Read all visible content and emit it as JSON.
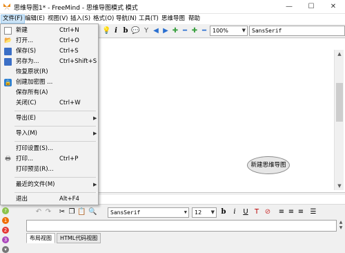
{
  "window": {
    "title": "思维导图1* - FreeMind - 思维导图模式 模式",
    "minimize": "—",
    "maximize": "☐",
    "close": "✕"
  },
  "menubar": {
    "items": [
      "文件(F)",
      "编辑(E)",
      "视图(V)",
      "插入(S)",
      "格式(O)",
      "导航(N)",
      "工具(T)",
      "思维导图",
      "帮助"
    ]
  },
  "toolbar": {
    "zoom": "100%",
    "font": "SansSerif"
  },
  "file_menu": {
    "items": [
      {
        "label": "新建",
        "shortcut": "Ctrl+N",
        "icon": "new-file-icon"
      },
      {
        "label": "打开...",
        "shortcut": "Ctrl+O",
        "icon": "open-folder-icon"
      },
      {
        "label": "保存(S)",
        "shortcut": "Ctrl+S",
        "icon": "save-icon"
      },
      {
        "label": "另存为...",
        "shortcut": "Ctrl+Shift+S",
        "icon": "save-as-icon"
      },
      {
        "label": "恢复原状(R)",
        "shortcut": ""
      },
      {
        "label": "创建加密图 ...",
        "shortcut": "",
        "icon": "lock-icon"
      },
      {
        "label": "保存所有(A)",
        "shortcut": ""
      },
      {
        "label": "关闭(C)",
        "shortcut": "Ctrl+W"
      },
      {
        "label": "导出(E)",
        "shortcut": "",
        "submenu": true
      },
      {
        "label": "导入(M)",
        "shortcut": "",
        "submenu": true
      },
      {
        "label": "打印设置(S)...",
        "shortcut": ""
      },
      {
        "label": "打印...",
        "shortcut": "Ctrl+P",
        "icon": "printer-icon"
      },
      {
        "label": "打印预览(R)...",
        "shortcut": ""
      },
      {
        "label": "最近的文件(M)",
        "shortcut": "",
        "submenu": true
      },
      {
        "label": "退出",
        "shortcut": "Alt+F4"
      }
    ]
  },
  "map": {
    "root_node": "新建思维导图"
  },
  "editor": {
    "font": "SansSerif",
    "size": "12",
    "tabs": [
      "布局视图",
      "HTML代码视图"
    ]
  }
}
